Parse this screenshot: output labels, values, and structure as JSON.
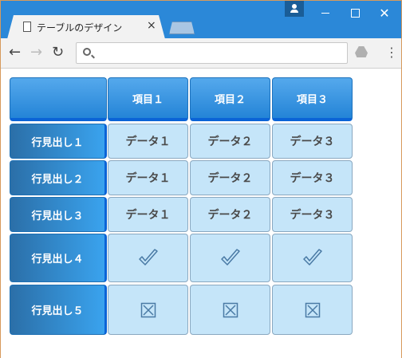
{
  "browser": {
    "tab_title": "テーブルのデザイン",
    "tab_close": "×",
    "address_value": ""
  },
  "table": {
    "corner": "",
    "columns": [
      "項目１",
      "項目２",
      "項目３"
    ],
    "rows": [
      {
        "header": "行見出し１",
        "cells": [
          "データ１",
          "データ２",
          "データ３"
        ]
      },
      {
        "header": "行見出し２",
        "cells": [
          "データ１",
          "データ２",
          "データ３"
        ]
      },
      {
        "header": "行見出し３",
        "cells": [
          "データ１",
          "データ２",
          "データ３"
        ]
      },
      {
        "header": "行見出し４",
        "cells": [
          "check",
          "check",
          "check"
        ]
      },
      {
        "header": "行見出し５",
        "cells": [
          "x-box",
          "x-box",
          "x-box"
        ]
      }
    ]
  },
  "colors": {
    "titlebar": "#2b88d8",
    "header_gradient_top": "#55a9ec",
    "header_gradient_bottom": "#2484d7",
    "cell_bg": "#c5e5f9",
    "icon": "#4a7aa5"
  }
}
